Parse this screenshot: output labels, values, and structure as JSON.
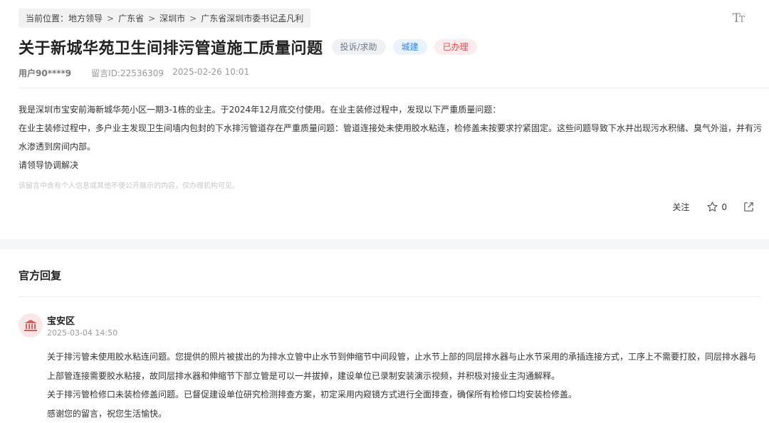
{
  "breadcrumb": {
    "items": [
      "当前位置：地方领导",
      "广东省",
      "深圳市",
      "广东省深圳市委书记孟凡利"
    ]
  },
  "font_toggle_label": "Tт",
  "message": {
    "title": "关于新城华苑卫生间排污管道施工质量问题",
    "tags": [
      {
        "label": "投诉/求助",
        "color": "#6b7a90"
      },
      {
        "label": "城建",
        "color": "#3d82d6"
      },
      {
        "label": "已办理",
        "color": "#e0474c"
      }
    ],
    "user": "用户90****9",
    "message_id": "留言ID:22536309",
    "datetime": "2025-02-26 10:01",
    "paragraphs": [
      "我是深圳市宝安前海新城华苑小区一期3-1栋的业主。于2024年12月底交付使用。在业主装修过程中，发现以下严重质量问题：",
      "在业主装修过程中，多户业主发现卫生间墙内包封的下水排污管道存在严重质量问题：管道连接处未使用胶水粘连，检修盖未按要求拧紧固定。这些问题导致下水井出现污水积储、臭气外溢，并有污水渗透到房间内部。",
      "请领导协调解决"
    ],
    "privacy_note": "该留言中含有个人信息或其他不便公开展示的内容，仅办理机构可见。"
  },
  "actions": {
    "follow_label": "关注",
    "like_count": "0"
  },
  "official_reply": {
    "section_title": "官方回复",
    "dept_name": "宝安区",
    "datetime": "2025-03-04 14:50",
    "paragraphs": [
      "关于排污管未使用胶水粘连问题。您提供的照片被拔出的为排水立管中止水节到伸缩节中间段管，止水节上部的同层排水器与止水节采用的承插连接方式，工序上不需要打胶，同层排水器与上部管连接需要胶水粘接，故同层排水器和伸缩节下部立管是可以一并拔掉，建设单位已录制安装演示视频，并积极对接业主沟通解释。",
      "关于排污管检修口未装检修盖问题。已督促建设单位研究检测排查方案，初定采用内窥镜方式进行全面排查，确保所有检修口均安装检修盖。",
      "感谢您的留言，祝您生活愉快。"
    ],
    "avatar_color": "#fbe7e7",
    "icon_color": "#e05a5a"
  }
}
